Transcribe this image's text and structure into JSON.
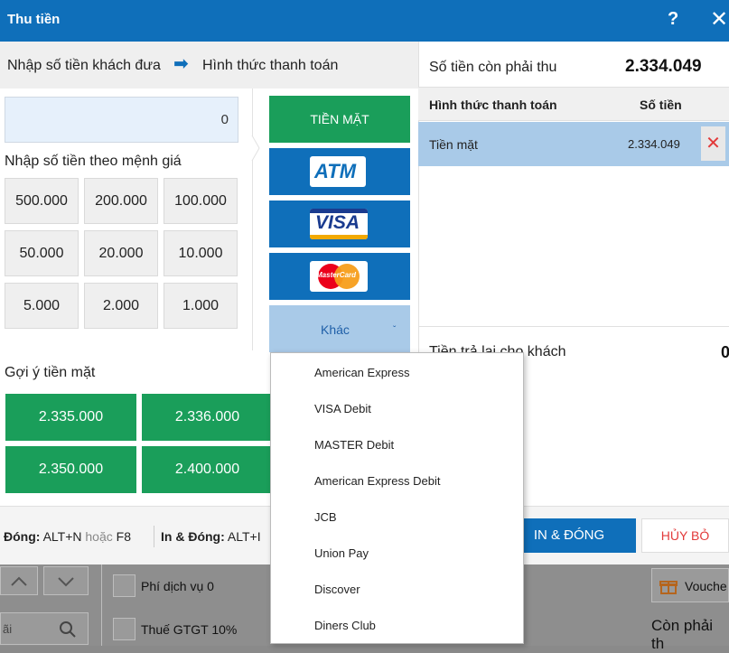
{
  "window": {
    "title": "Thu tiền",
    "help": "?",
    "close": "✕"
  },
  "steps": {
    "step1": "Nhập số tiền khách đưa",
    "arrow": "➡",
    "step2": "Hình thức thanh toán"
  },
  "amount_input": {
    "value": "0"
  },
  "denominations": {
    "title": "Nhập số tiền theo mệnh giá",
    "items": [
      "500.000",
      "200.000",
      "100.000",
      "50.000",
      "20.000",
      "10.000",
      "5.000",
      "2.000",
      "1.000"
    ]
  },
  "payment_methods": {
    "cash": "TIỀN MẶT",
    "atm": "ATM",
    "visa": "VISA",
    "mastercard": "MasterCard",
    "other": "Khác",
    "other_caret": "ˇ"
  },
  "cash_suggestions": {
    "title": "Gợi ý tiền mặt",
    "items": [
      "2.335.000",
      "2.336.000",
      "2.350.000",
      "2.400.000"
    ]
  },
  "summary": {
    "remaining_label": "Số tiền còn phải thu",
    "remaining_value": "2.334.049",
    "table_headers": [
      "Hình thức thanh toán",
      "Số tiền"
    ],
    "rows": [
      {
        "method": "Tiền mặt",
        "amount": "2.334.049",
        "remove": "✕"
      }
    ],
    "change_label": "Tiền trả lại cho khách",
    "change_value": "0"
  },
  "footer": {
    "close_label": "Đóng:",
    "close_keys": "ALT+N",
    "or": "hoặc",
    "close_alt": "F8",
    "print_label": "In & Đóng:",
    "print_keys": "ALT+I",
    "print_button": "IN & ĐÓNG",
    "cancel_button": "HỦY BỎ"
  },
  "dropdown": {
    "options": [
      "American Express",
      "VISA Debit",
      "MASTER Debit",
      "American Express Debit",
      "JCB",
      "Union Pay",
      "Discover",
      "Diners Club"
    ]
  },
  "background": {
    "service_fee": "Phí dịch vụ 0",
    "vat": "Thuế GTGT 10%",
    "voucher": "Vouche",
    "remaining_partial": "Còn phải th",
    "search_partial": "ãi"
  }
}
